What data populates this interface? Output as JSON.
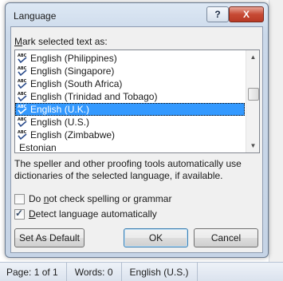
{
  "dialog": {
    "title": "Language",
    "help_button": "?",
    "close_button": "X",
    "mark_label_underlined": "M",
    "mark_label_rest": "ark selected text as:",
    "languages": [
      {
        "name": "English (Philippines)",
        "spellcheck_icon": true,
        "selected": false
      },
      {
        "name": "English (Singapore)",
        "spellcheck_icon": true,
        "selected": false
      },
      {
        "name": "English (South Africa)",
        "spellcheck_icon": true,
        "selected": false
      },
      {
        "name": "English (Trinidad and Tobago)",
        "spellcheck_icon": true,
        "selected": false
      },
      {
        "name": "English (U.K.)",
        "spellcheck_icon": true,
        "selected": true
      },
      {
        "name": "English (U.S.)",
        "spellcheck_icon": true,
        "selected": false
      },
      {
        "name": "English (Zimbabwe)",
        "spellcheck_icon": true,
        "selected": false
      },
      {
        "name": "Estonian",
        "spellcheck_icon": false,
        "selected": false
      }
    ],
    "description": "The speller and other proofing tools automatically use dictionaries of the selected language, if available.",
    "checkbox_no_check": {
      "underlined": "n",
      "before": "Do ",
      "after": "ot check spelling or grammar",
      "checked": false
    },
    "checkbox_detect": {
      "underlined": "D",
      "after": "etect language automatically",
      "checked": true
    },
    "set_default_label": "Set As Default",
    "ok_label": "OK",
    "cancel_label": "Cancel"
  },
  "statusbar": {
    "page": "Page: 1 of 1",
    "words": "Words: 0",
    "language": "English (U.S.)"
  }
}
